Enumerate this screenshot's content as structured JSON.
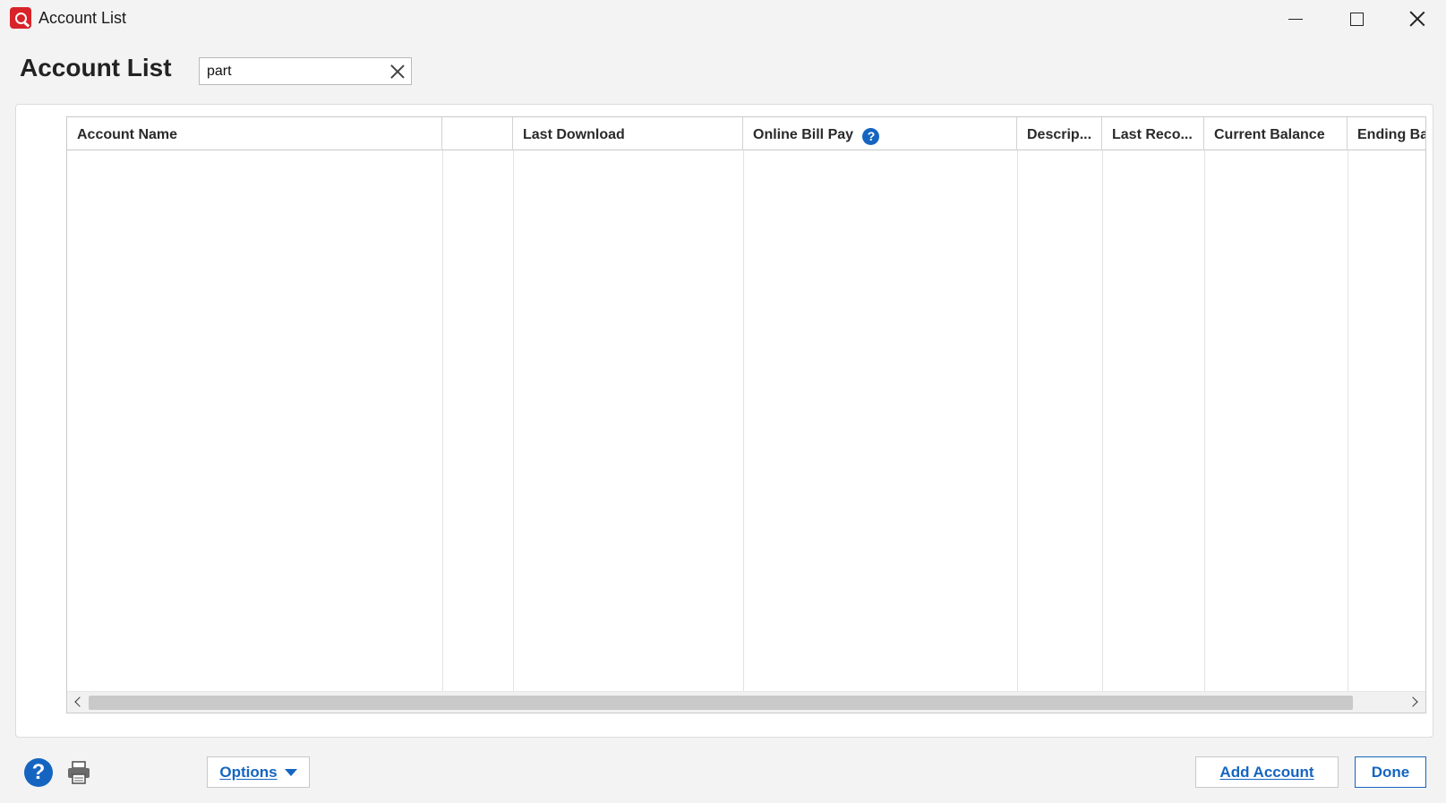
{
  "window": {
    "title": "Account List",
    "app_icon": "quicken-q-icon",
    "controls": [
      "minimize-icon",
      "maximize-icon",
      "close-icon"
    ]
  },
  "header": {
    "page_title": "Account List",
    "search_value": "part"
  },
  "grid": {
    "columns": [
      {
        "label": "Account Name"
      },
      {
        "label": ""
      },
      {
        "label": "Last Download"
      },
      {
        "label": "Online Bill Pay"
      },
      {
        "label": "Descrip..."
      },
      {
        "label": "Last Reco..."
      },
      {
        "label": "Current Balance"
      },
      {
        "label": "Ending Ba"
      }
    ],
    "help_glyph": "?",
    "rows": []
  },
  "footer": {
    "help_glyph": "?",
    "options_label": "Options",
    "add_account_label": "Add Account",
    "done_label": "Done"
  },
  "colors": {
    "accent": "#1565c0",
    "brand": "#d8232a"
  }
}
